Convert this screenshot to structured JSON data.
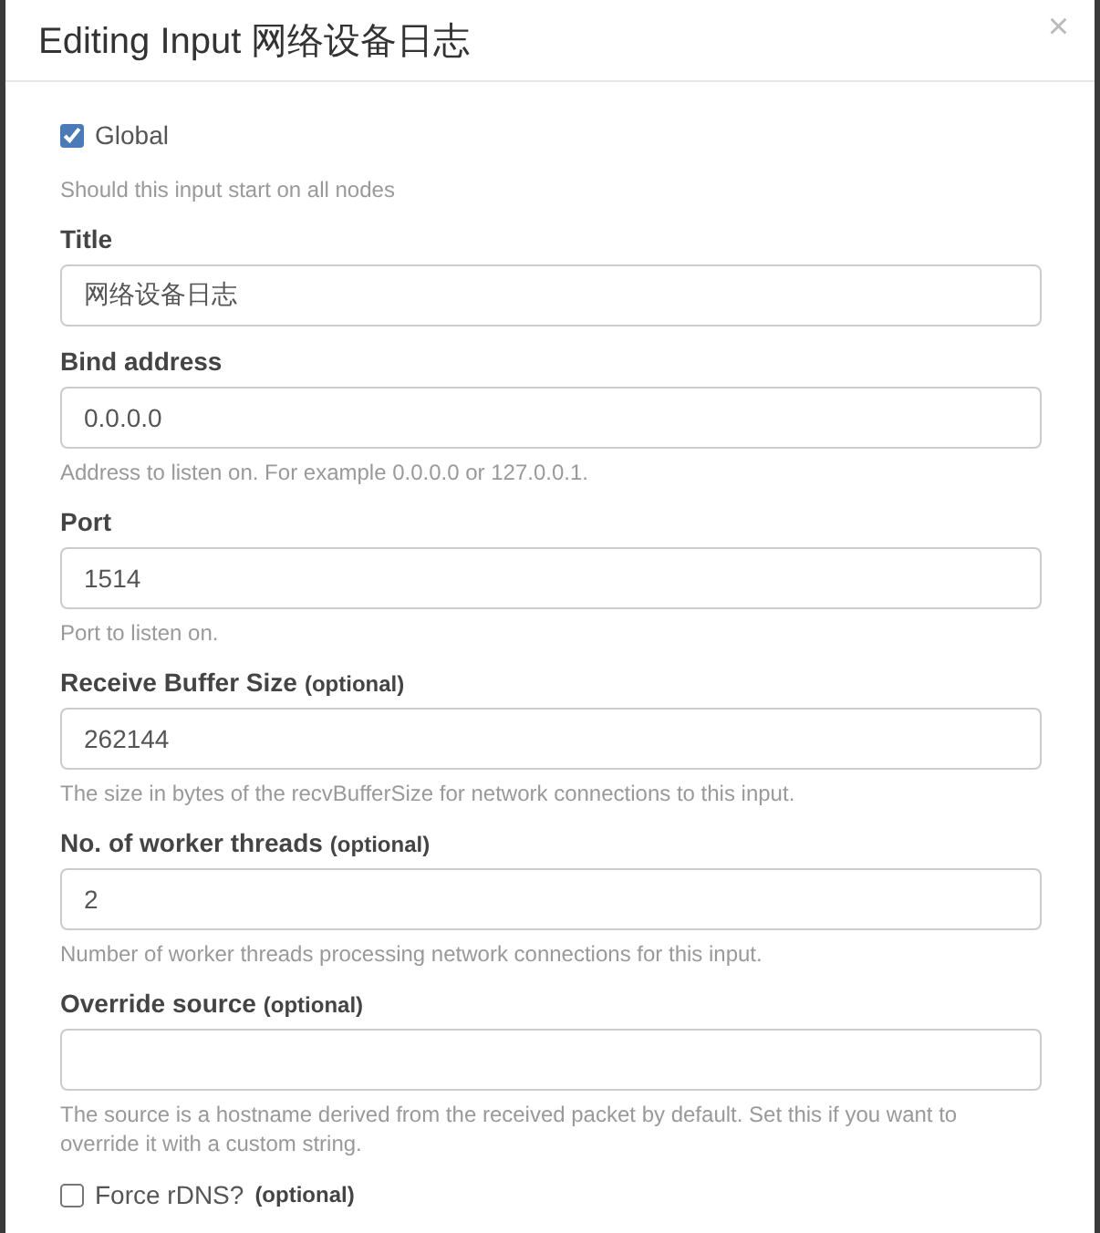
{
  "dialog": {
    "title": "Editing Input 网络设备日志",
    "close": "×"
  },
  "fields": [
    {
      "kind": "checkbox",
      "label": "Global",
      "checked": true,
      "help": "Should this input start on all nodes"
    },
    {
      "kind": "text",
      "label": "Title",
      "value": "网络设备日志"
    },
    {
      "kind": "text",
      "label": "Bind address",
      "value": "0.0.0.0",
      "help": "Address to listen on. For example 0.0.0.0 or 127.0.0.1."
    },
    {
      "kind": "text",
      "label": "Port",
      "value": "1514",
      "help": "Port to listen on."
    },
    {
      "kind": "text",
      "label": "Receive Buffer Size",
      "optional": "(optional)",
      "value": "262144",
      "help": "The size in bytes of the recvBufferSize for network connections to this input."
    },
    {
      "kind": "text",
      "label": "No. of worker threads",
      "optional": "(optional)",
      "value": "2",
      "help": "Number of worker threads processing network connections for this input."
    },
    {
      "kind": "text",
      "label": "Override source",
      "optional": "(optional)",
      "help": "The source is a hostname derived from the received packet by default. Set this if you want to override it with a custom string."
    },
    {
      "kind": "checkbox",
      "label": "Force rDNS?",
      "optional": "(optional)",
      "checked": false
    }
  ]
}
